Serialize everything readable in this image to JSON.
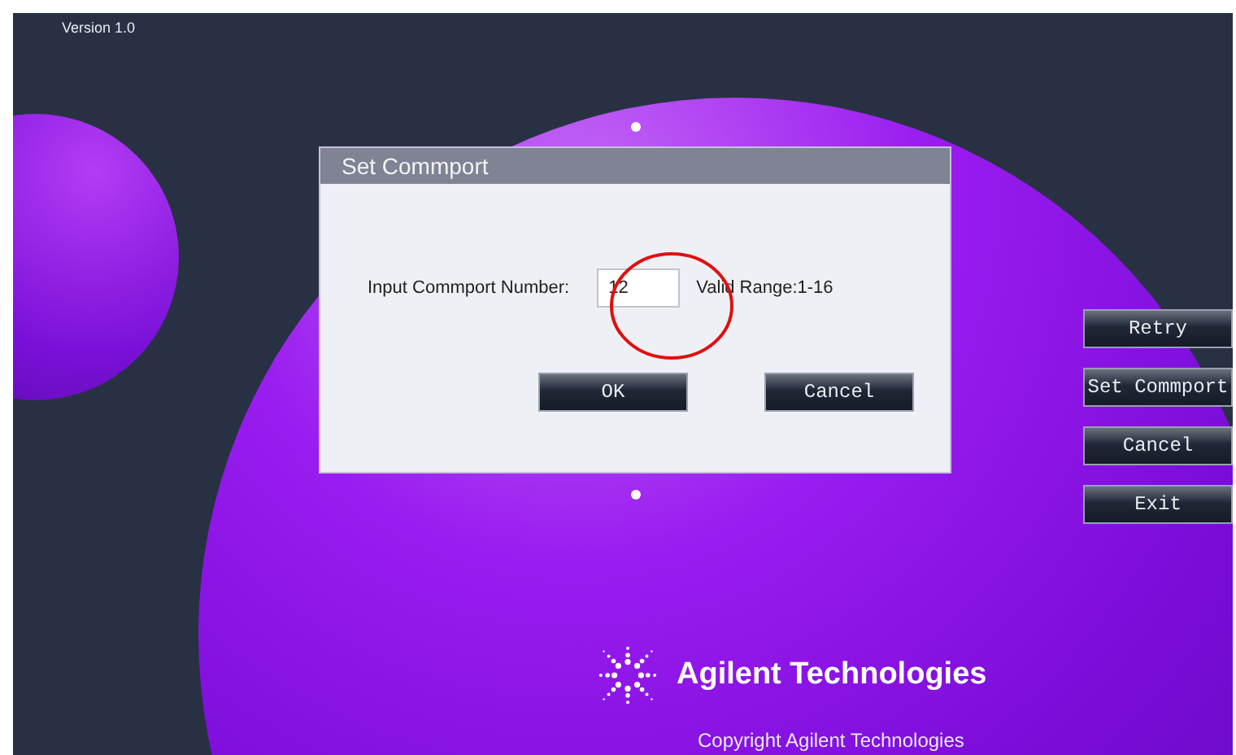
{
  "version": "Version 1.0",
  "dialog": {
    "title": "Set Commport",
    "field_label": "Input Commport Number:",
    "value": "12",
    "hint": "Valid Range:1-16",
    "buttons": [
      "OK",
      "Cancel"
    ]
  },
  "side_buttons": [
    "Retry",
    "Set Commport",
    "Cancel",
    "Exit"
  ],
  "brand": "Agilent Technologies",
  "copyright": "Copyright Agilent Technologies"
}
